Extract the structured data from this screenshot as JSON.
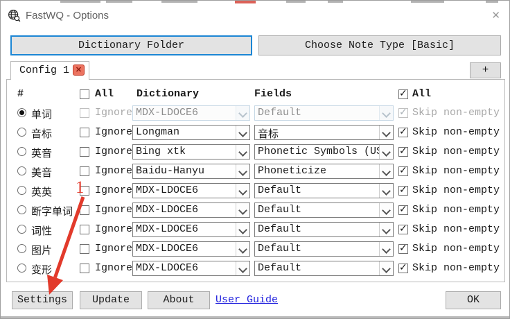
{
  "window": {
    "title": "FastWQ - Options"
  },
  "icons": {
    "close": "✕",
    "tab_close": "✕",
    "app_icon": "globe-with-magnifier"
  },
  "toolbar": {
    "dictionary_folder_label": "Dictionary Folder",
    "choose_note_type_label": "Choose Note Type [Basic]"
  },
  "tab_bar": {
    "active_tab": "Config 1",
    "add_tab_label": "+"
  },
  "table": {
    "headers": {
      "index": "#",
      "all_left": "All",
      "dictionary": "Dictionary",
      "fields": "Fields",
      "all_right": "All"
    },
    "all_left_checked": false,
    "all_right_checked": true,
    "ignore_label": "Ignore",
    "skip_label": "Skip non-empty",
    "rows": [
      {
        "label": "单词",
        "selected": true,
        "disabled": true,
        "ignore_checked": false,
        "dictionary": "MDX-LDOCE6",
        "fields": "Default",
        "skip_checked": true
      },
      {
        "label": "音标",
        "selected": false,
        "disabled": false,
        "ignore_checked": false,
        "dictionary": "Longman",
        "fields": "音标",
        "skip_checked": true
      },
      {
        "label": "英音",
        "selected": false,
        "disabled": false,
        "ignore_checked": false,
        "dictionary": "Bing xtk",
        "fields": "Phonetic Symbols (US)",
        "skip_checked": true
      },
      {
        "label": "美音",
        "selected": false,
        "disabled": false,
        "ignore_checked": false,
        "dictionary": "Baidu-Hanyu",
        "fields": "Phoneticize",
        "skip_checked": true
      },
      {
        "label": "英英",
        "selected": false,
        "disabled": false,
        "ignore_checked": false,
        "dictionary": "MDX-LDOCE6",
        "fields": "Default",
        "skip_checked": true
      },
      {
        "label": "断字单词",
        "selected": false,
        "disabled": false,
        "ignore_checked": false,
        "dictionary": "MDX-LDOCE6",
        "fields": "Default",
        "skip_checked": true
      },
      {
        "label": "词性",
        "selected": false,
        "disabled": false,
        "ignore_checked": false,
        "dictionary": "MDX-LDOCE6",
        "fields": "Default",
        "skip_checked": true
      },
      {
        "label": "图片",
        "selected": false,
        "disabled": false,
        "ignore_checked": false,
        "dictionary": "MDX-LDOCE6",
        "fields": "Default",
        "skip_checked": true
      },
      {
        "label": "变形",
        "selected": false,
        "disabled": false,
        "ignore_checked": false,
        "dictionary": "MDX-LDOCE6",
        "fields": "Default",
        "skip_checked": true
      }
    ]
  },
  "footer": {
    "settings_label": "Settings",
    "update_label": "Update",
    "about_label": "About",
    "user_guide_label": "User Guide",
    "ok_label": "OK"
  },
  "annotation": {
    "step_number": "1",
    "arrow_color": "#e23a2b"
  },
  "colors": {
    "focus_border_blue": "#1c86d4",
    "annotation_red": "#e23a2b",
    "link_blue": "#2121dd",
    "button_bg": "#e3e3e3",
    "tab_close_red": "#bf3d2a"
  }
}
